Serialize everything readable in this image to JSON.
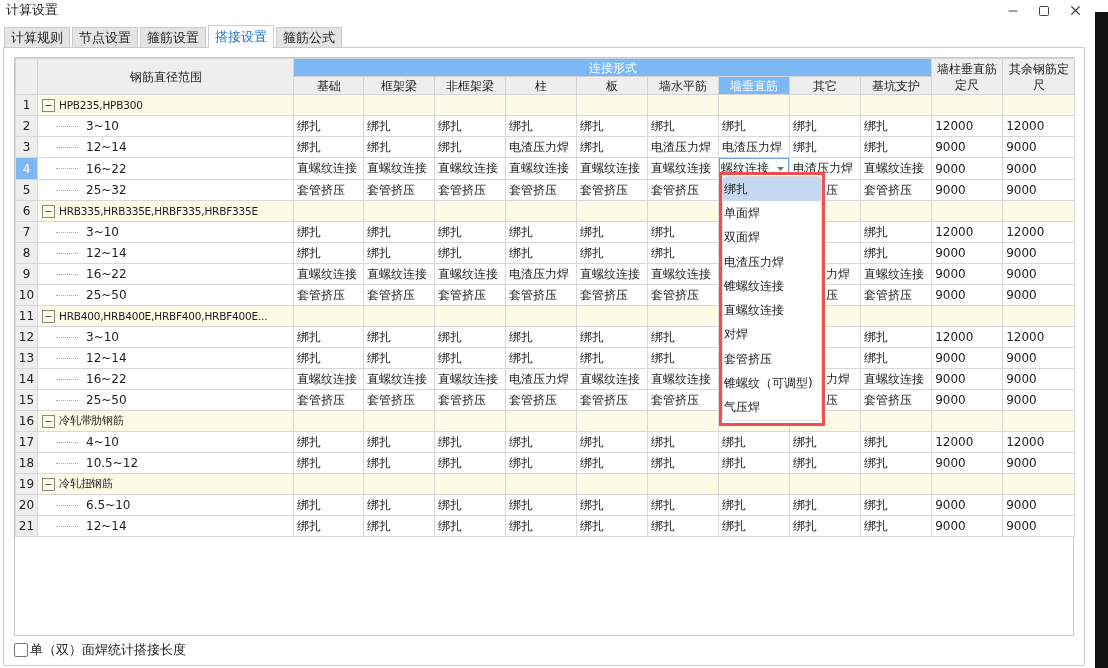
{
  "window": {
    "title": "计算设置"
  },
  "tabs": [
    {
      "label": "计算规则",
      "selected": false
    },
    {
      "label": "节点设置",
      "selected": false
    },
    {
      "label": "箍筋设置",
      "selected": false
    },
    {
      "label": "搭接设置",
      "selected": true
    },
    {
      "label": "箍筋公式",
      "selected": false
    }
  ],
  "table": {
    "tree_column": "钢筋直径范围",
    "group_header": "连接形式",
    "columns": [
      {
        "label": "基础",
        "selected": false
      },
      {
        "label": "框架梁",
        "selected": false
      },
      {
        "label": "非框架梁",
        "selected": false
      },
      {
        "label": "柱",
        "selected": false
      },
      {
        "label": "板",
        "selected": false
      },
      {
        "label": "墙水平筋",
        "selected": false
      },
      {
        "label": "墙垂直筋",
        "selected": true
      },
      {
        "label": "其它",
        "selected": false
      },
      {
        "label": "基坑支护",
        "selected": false
      }
    ],
    "length_columns": [
      "墙柱垂直筋定尺",
      "其余钢筋定尺"
    ],
    "groups": [
      {
        "number": "1",
        "label": "HPB235,HPB300",
        "expanded": true,
        "children": [
          {
            "number": "2",
            "label": "3~10",
            "selected": false,
            "cells": [
              "绑扎",
              "绑扎",
              "绑扎",
              "绑扎",
              "绑扎",
              "绑扎",
              "绑扎",
              "绑扎",
              "绑扎",
              "12000",
              "12000"
            ]
          },
          {
            "number": "3",
            "label": "12~14",
            "selected": false,
            "cells": [
              "绑扎",
              "绑扎",
              "绑扎",
              "电渣压力焊",
              "绑扎",
              "电渣压力焊",
              "电渣压力焊",
              "绑扎",
              "绑扎",
              "9000",
              "9000"
            ]
          },
          {
            "number": "4",
            "label": "16~22",
            "selected": true,
            "cells": [
              "直螺纹连接",
              "直螺纹连接",
              "直螺纹连接",
              "直螺纹连接",
              "直螺纹连接",
              "直螺纹连接",
              null,
              "电渣压力焊",
              "直螺纹连接",
              "9000",
              "9000"
            ],
            "editor": {
              "value": "螺纹连接",
              "options": [
                {
                  "label": "绑扎",
                  "selected": true
                },
                {
                  "label": "单面焊",
                  "selected": false
                },
                {
                  "label": "双面焊",
                  "selected": false
                },
                {
                  "label": "电渣压力焊",
                  "selected": false
                },
                {
                  "label": "锥螺纹连接",
                  "selected": false
                },
                {
                  "label": "直螺纹连接",
                  "selected": false
                },
                {
                  "label": "对焊",
                  "selected": false
                },
                {
                  "label": "套管挤压",
                  "selected": false
                },
                {
                  "label": "锥螺纹（可调型)",
                  "selected": false
                },
                {
                  "label": "气压焊",
                  "selected": false
                }
              ]
            }
          },
          {
            "number": "5",
            "label": "25~32",
            "selected": false,
            "cells": [
              "套管挤压",
              "套管挤压",
              "套管挤压",
              "套管挤压",
              "套管挤压",
              "套管挤压",
              null,
              "压",
              "套管挤压",
              "9000",
              "9000"
            ]
          }
        ]
      },
      {
        "number": "6",
        "label": "HRB335,HRB335E,HRBF335,HRBF335E",
        "expanded": true,
        "children": [
          {
            "number": "7",
            "label": "3~10",
            "selected": false,
            "cells": [
              "绑扎",
              "绑扎",
              "绑扎",
              "绑扎",
              "绑扎",
              "绑扎",
              null,
              null,
              "绑扎",
              "12000",
              "12000"
            ]
          },
          {
            "number": "8",
            "label": "12~14",
            "selected": false,
            "cells": [
              "绑扎",
              "绑扎",
              "绑扎",
              "绑扎",
              "绑扎",
              "绑扎",
              null,
              null,
              "绑扎",
              "9000",
              "9000"
            ]
          },
          {
            "number": "9",
            "label": "16~22",
            "selected": false,
            "cells": [
              "直螺纹连接",
              "直螺纹连接",
              "直螺纹连接",
              "电渣压力焊",
              "直螺纹连接",
              "直螺纹连接",
              null,
              "力焊",
              "直螺纹连接",
              "9000",
              "9000"
            ]
          },
          {
            "number": "10",
            "label": "25~50",
            "selected": false,
            "cells": [
              "套管挤压",
              "套管挤压",
              "套管挤压",
              "套管挤压",
              "套管挤压",
              "套管挤压",
              null,
              "压",
              "套管挤压",
              "9000",
              "9000"
            ]
          }
        ]
      },
      {
        "number": "11",
        "label": "HRB400,HRB400E,HRBF400,HRBF400E...",
        "expanded": true,
        "children": [
          {
            "number": "12",
            "label": "3~10",
            "selected": false,
            "cells": [
              "绑扎",
              "绑扎",
              "绑扎",
              "绑扎",
              "绑扎",
              "绑扎",
              null,
              null,
              "绑扎",
              "12000",
              "12000"
            ]
          },
          {
            "number": "13",
            "label": "12~14",
            "selected": false,
            "cells": [
              "绑扎",
              "绑扎",
              "绑扎",
              "绑扎",
              "绑扎",
              "绑扎",
              null,
              null,
              "绑扎",
              "9000",
              "9000"
            ]
          },
          {
            "number": "14",
            "label": "16~22",
            "selected": false,
            "cells": [
              "直螺纹连接",
              "直螺纹连接",
              "直螺纹连接",
              "电渣压力焊",
              "直螺纹连接",
              "直螺纹连接",
              null,
              "力焊",
              "直螺纹连接",
              "9000",
              "9000"
            ]
          },
          {
            "number": "15",
            "label": "25~50",
            "selected": false,
            "cells": [
              "套管挤压",
              "套管挤压",
              "套管挤压",
              "套管挤压",
              "套管挤压",
              "套管挤压",
              null,
              "压",
              "套管挤压",
              "9000",
              "9000"
            ]
          }
        ]
      },
      {
        "number": "16",
        "label": "冷轧带肋钢筋",
        "expanded": true,
        "children": [
          {
            "number": "17",
            "label": "4~10",
            "selected": false,
            "cells": [
              "绑扎",
              "绑扎",
              "绑扎",
              "绑扎",
              "绑扎",
              "绑扎",
              "绑扎",
              "绑扎",
              "绑扎",
              "12000",
              "12000"
            ]
          },
          {
            "number": "18",
            "label": "10.5~12",
            "selected": false,
            "cells": [
              "绑扎",
              "绑扎",
              "绑扎",
              "绑扎",
              "绑扎",
              "绑扎",
              "绑扎",
              "绑扎",
              "绑扎",
              "9000",
              "9000"
            ]
          }
        ]
      },
      {
        "number": "19",
        "label": "冷轧扭钢筋",
        "expanded": true,
        "children": [
          {
            "number": "20",
            "label": "6.5~10",
            "selected": false,
            "cells": [
              "绑扎",
              "绑扎",
              "绑扎",
              "绑扎",
              "绑扎",
              "绑扎",
              "绑扎",
              "绑扎",
              "绑扎",
              "9000",
              "9000"
            ]
          },
          {
            "number": "21",
            "label": "12~14",
            "selected": false,
            "cells": [
              "绑扎",
              "绑扎",
              "绑扎",
              "绑扎",
              "绑扎",
              "绑扎",
              "绑扎",
              "绑扎",
              "绑扎",
              "9000",
              "9000"
            ]
          }
        ]
      }
    ]
  },
  "option": {
    "label": "单（双）面焊统计搭接长度",
    "checked": false
  }
}
